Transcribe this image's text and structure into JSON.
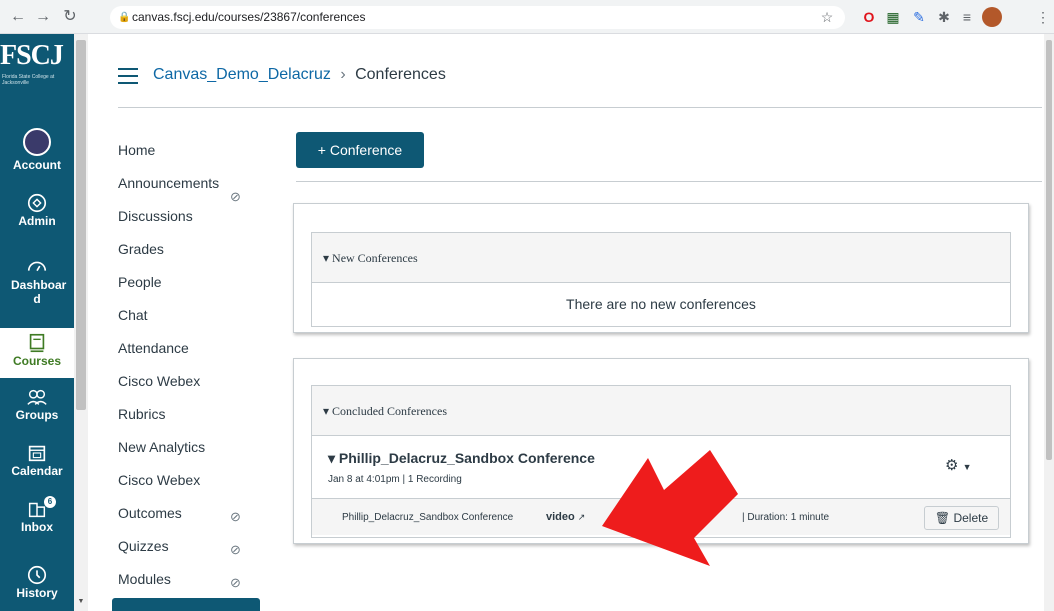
{
  "browser": {
    "url": "canvas.fscj.edu/courses/23867/conferences"
  },
  "global_nav": {
    "logo": "FSCJ",
    "logo_sub": "Florida State College at Jacksonville",
    "items": [
      {
        "label": "Account",
        "icon": "avatar-icon"
      },
      {
        "label": "Admin",
        "icon": "shield-icon"
      },
      {
        "label": "Dashboar d",
        "icon": "dashboard-icon"
      },
      {
        "label": "Courses",
        "icon": "book-icon",
        "active": true
      },
      {
        "label": "Groups",
        "icon": "groups-icon"
      },
      {
        "label": "Calendar",
        "icon": "calendar-icon"
      },
      {
        "label": "Inbox",
        "icon": "inbox-icon",
        "badge": "6"
      },
      {
        "label": "History",
        "icon": "clock-icon"
      }
    ]
  },
  "breadcrumb": {
    "course": "Canvas_Demo_Delacruz",
    "separator": "›",
    "page": "Conferences"
  },
  "course_nav": [
    {
      "label": "Home"
    },
    {
      "label": "Announcements",
      "hidden": true
    },
    {
      "label": "Discussions"
    },
    {
      "label": "Grades"
    },
    {
      "label": "People"
    },
    {
      "label": "Chat"
    },
    {
      "label": "Attendance"
    },
    {
      "label": "Cisco Webex"
    },
    {
      "label": "Rubrics"
    },
    {
      "label": "New Analytics"
    },
    {
      "label": "Cisco Webex"
    },
    {
      "label": "Outcomes",
      "hidden": true
    },
    {
      "label": "Quizzes",
      "hidden": true
    },
    {
      "label": "Modules",
      "hidden": true
    }
  ],
  "toolbar": {
    "add_conference_label": "+ Conference"
  },
  "new_conferences": {
    "heading": "▾  New Conferences",
    "empty_message": "There are no new conferences"
  },
  "concluded_conferences": {
    "heading": "▾  Concluded Conferences",
    "conference": {
      "title": "▾  Phillip_Delacruz_Sandbox Conference",
      "meta": "Jan 8 at 4:01pm  |  1 Recording",
      "recording": {
        "name": "Phillip_Delacruz_Sandbox Conference",
        "link_label": "video",
        "duration": "|  Duration: 1 minute",
        "delete_label": "Delete"
      }
    }
  },
  "colors": {
    "nav_bg": "#0e5874",
    "link": "#0e68a5",
    "active_nav_text": "#3f7b24",
    "arrow": "#ee1c1c"
  }
}
